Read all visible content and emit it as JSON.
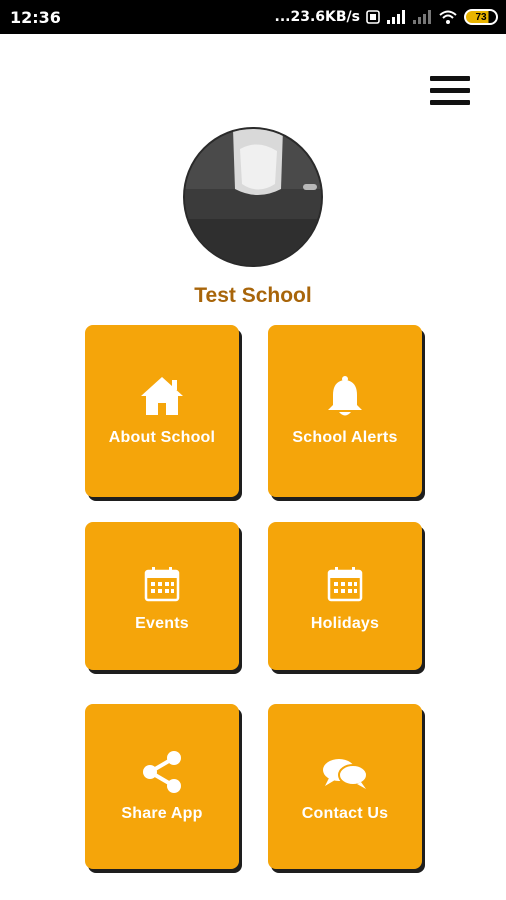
{
  "status_bar": {
    "time": "12:36",
    "network_speed": "...23.6KB/s",
    "battery_level": "73"
  },
  "header": {
    "menu_icon": "hamburger-menu-icon"
  },
  "school": {
    "name": "Test School",
    "avatar_icon": "school-photo"
  },
  "tiles": [
    {
      "label": "About School",
      "icon": "home-icon"
    },
    {
      "label": "School Alerts",
      "icon": "bell-icon"
    },
    {
      "label": "Events",
      "icon": "calendar-icon"
    },
    {
      "label": "Holidays",
      "icon": "calendar-icon"
    },
    {
      "label": "Share App",
      "icon": "share-icon"
    },
    {
      "label": "Contact Us",
      "icon": "chat-bubbles-icon"
    }
  ],
  "colors": {
    "tile_background": "#f5a50a",
    "school_name": "#a8650a",
    "status_bar": "#000000"
  }
}
